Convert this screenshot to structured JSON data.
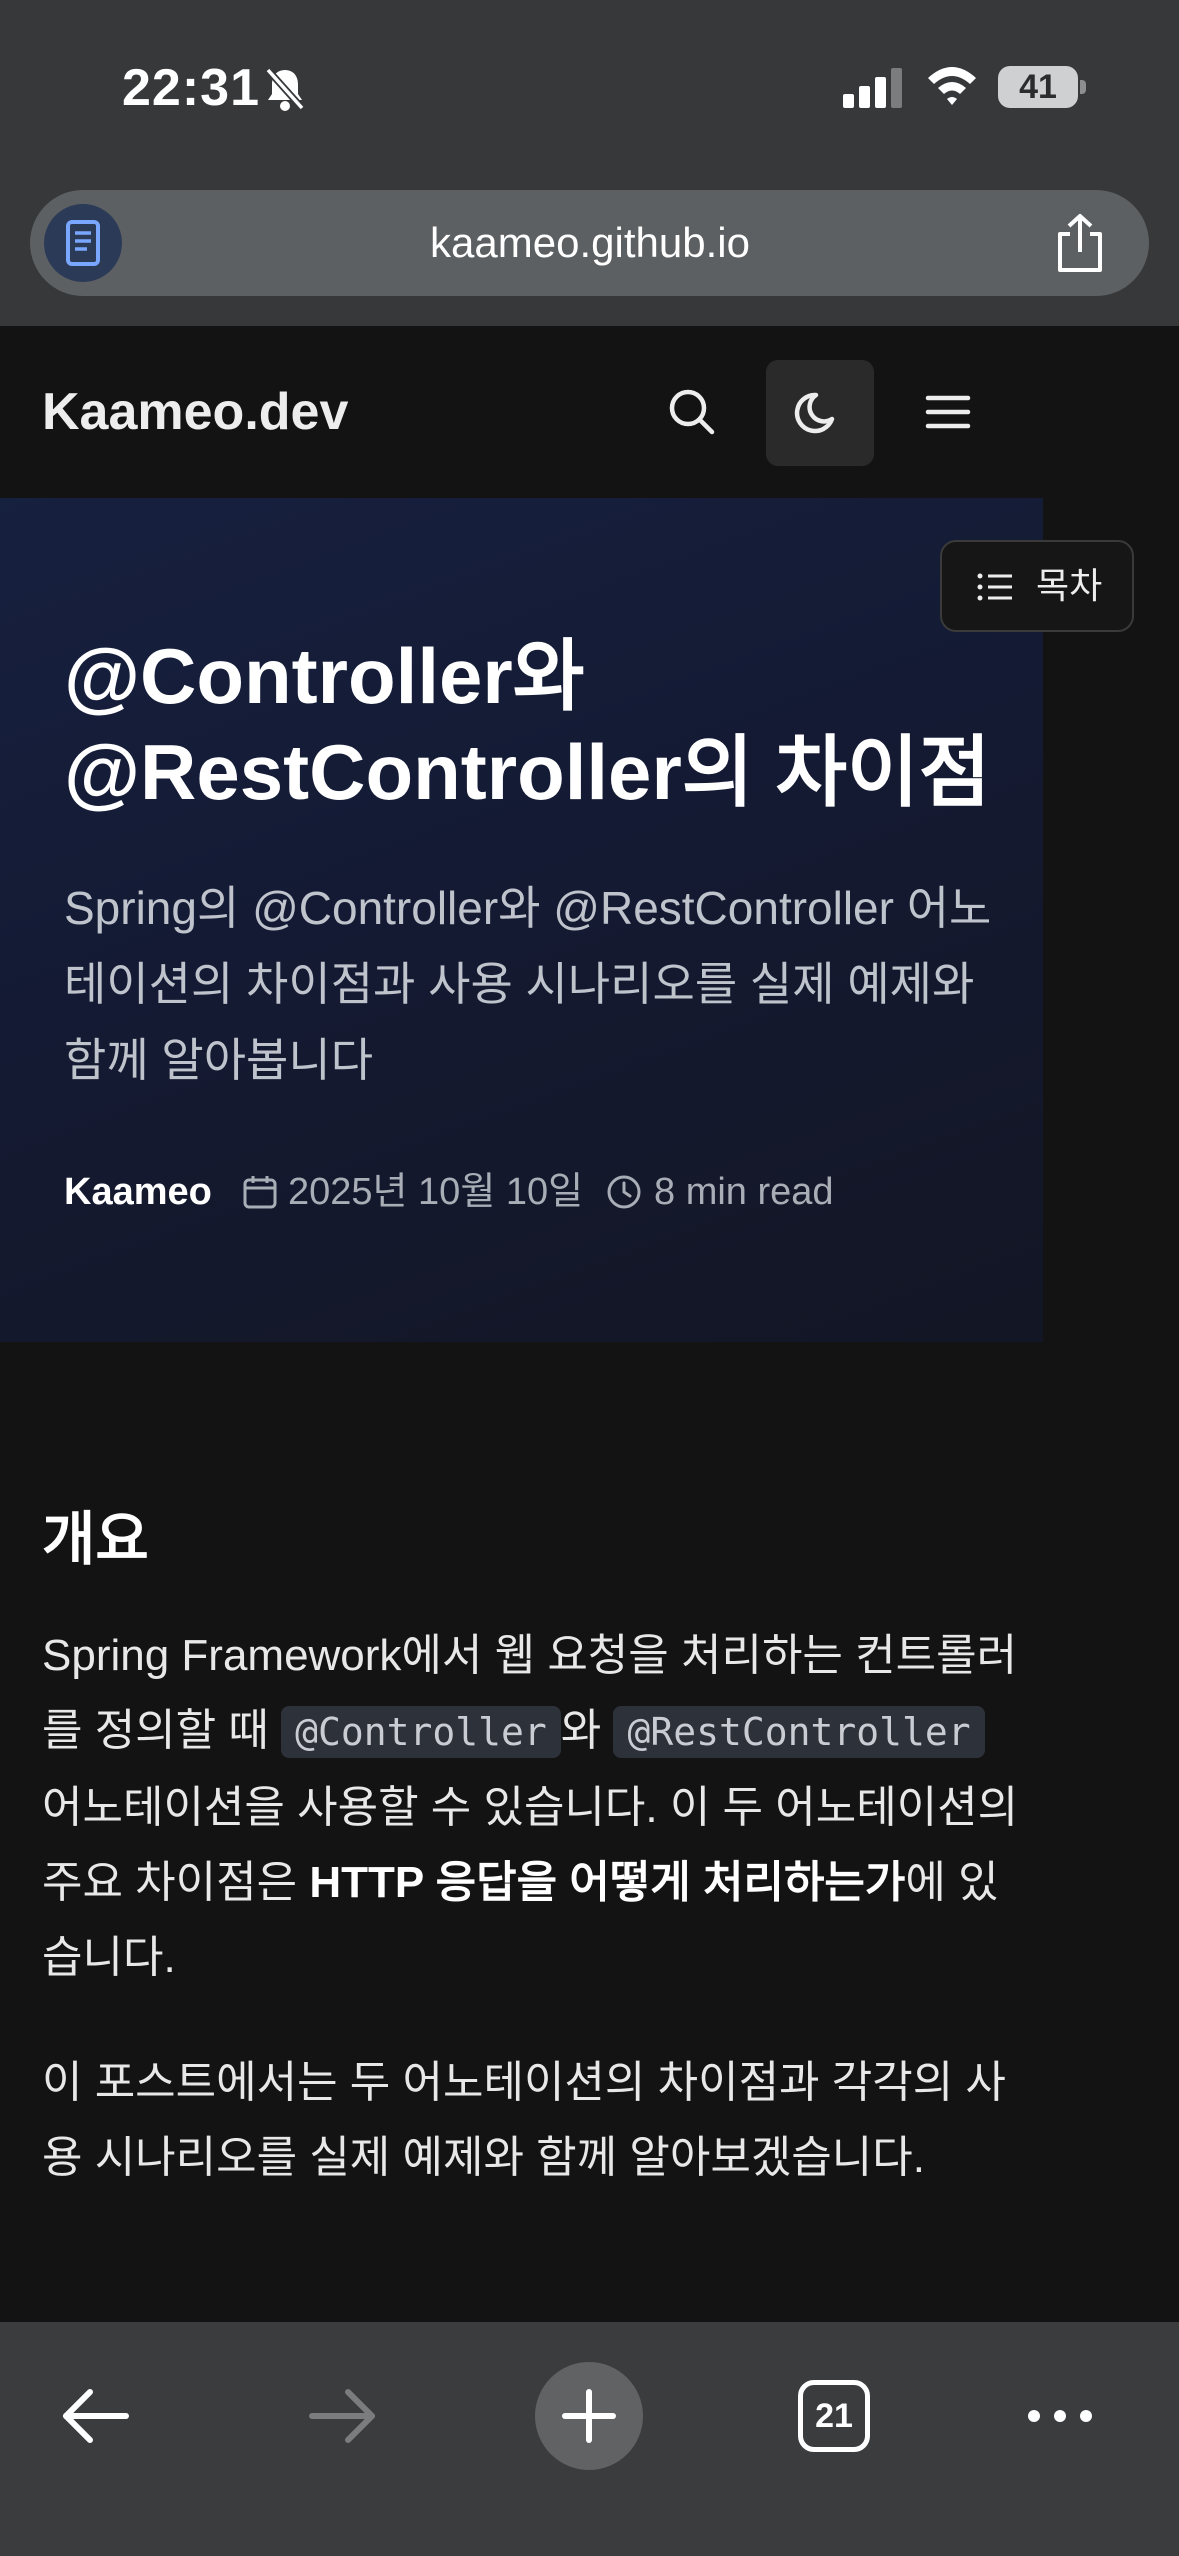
{
  "status_bar": {
    "time": "22:31",
    "battery_level": "41",
    "icons": [
      "bell-off-icon",
      "signal-icon",
      "wifi-icon",
      "battery-icon"
    ]
  },
  "browser": {
    "url": "kaameo.github.io",
    "tab_count": "21",
    "icons": [
      "reader-icon",
      "share-icon",
      "back-arrow-icon",
      "forward-arrow-icon",
      "plus-icon",
      "tabs-icon",
      "more-icon"
    ]
  },
  "site": {
    "logo": "Kaameo.dev",
    "icons": [
      "search-icon",
      "moon-icon",
      "hamburger-menu-icon"
    ]
  },
  "post": {
    "title_line1": "@Controller와",
    "title_line2": "@RestController의 차이점",
    "description": "Spring의 @Controller와 @RestController 어노테이션의 차이점과 사용 시나리오를 실제 예제와 함께 알아봅니다",
    "author": "Kaameo",
    "date": "2025년 10월 10일",
    "read_time": "8 min read",
    "toc_label": "목차"
  },
  "content": {
    "heading": "개요",
    "p1": {
      "part1": "Spring Framework에서 웹 요청을 처리하는 컨트롤러를 정의할 때 ",
      "code1": "@Controller",
      "part2": "와 ",
      "code2": "@RestController",
      "part3": " 어노테이션을 사용할 수 있습니다. 이 두 어노테이션의 주요 차이점은 ",
      "bold": "HTTP 응답을 어떻게 처리하는가",
      "part4": "에 있습니다."
    },
    "p2": "이 포스트에서는 두 어노테이션의 차이점과 각각의 사용 시나리오를 실제 예제와 함께 알아보겠습니다."
  },
  "colors": {
    "page_bg": "#131313",
    "chrome_bg": "#36383a",
    "hero_bg": "#16203f",
    "code_bg": "#2d313a"
  }
}
